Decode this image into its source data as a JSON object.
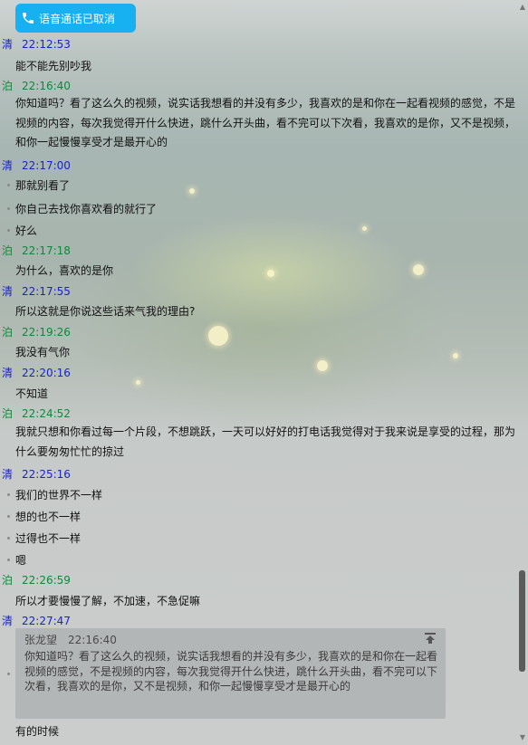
{
  "call_banner": {
    "text": "语音通话已取消",
    "icon": "phone-icon",
    "color": "#17b0f0"
  },
  "colors": {
    "qing": "#1a23c8",
    "bo": "#0a8a3a"
  },
  "messages": [
    {
      "sender": "清",
      "time": "22:12:53",
      "lines": [
        "能不能先别吵我"
      ]
    },
    {
      "sender": "泊",
      "time": "22:16:40",
      "paragraph": "你知道吗？看了这么久的视频，说实话我想看的并没有多少，我喜欢的是和你在一起看视频的感觉，不是视频的内容，每次我觉得开什么快进，跳什么开头曲，看不完可以下次看，我喜欢的是你，又不是视频，和你一起慢慢享受才是最开心的"
    },
    {
      "sender": "清",
      "time": "22:17:00",
      "lines": [
        "那就别看了",
        "你自己去找你喜欢看的就行了",
        "好么"
      ]
    },
    {
      "sender": "泊",
      "time": "22:17:18",
      "lines": [
        "为什么，喜欢的是你"
      ]
    },
    {
      "sender": "清",
      "time": "22:17:55",
      "lines": [
        "所以这就是你说这些话来气我的理由?"
      ]
    },
    {
      "sender": "泊",
      "time": "22:19:26",
      "lines": [
        "我没有气你"
      ]
    },
    {
      "sender": "清",
      "time": "22:20:16",
      "lines": [
        "不知道"
      ]
    },
    {
      "sender": "泊",
      "time": "22:24:52",
      "paragraph": "我就只想和你看过每一个片段，不想跳跃，一天可以好好的打电话我觉得对于我来说是享受的过程，那为什么要匆匆忙忙的掠过"
    },
    {
      "sender": "清",
      "time": "22:25:16",
      "lines": [
        "我们的世界不一样",
        "想的也不一样",
        "过得也不一样",
        "嗯"
      ]
    },
    {
      "sender": "泊",
      "time": "22:26:59",
      "lines": [
        "所以才要慢慢了解，不加速，不急促嘛"
      ]
    },
    {
      "sender": "清",
      "time": "22:27:47",
      "lines": [
        "有的时候"
      ]
    }
  ],
  "quote": {
    "name": "张龙望",
    "time": "22:16:40",
    "text": "你知道吗？看了这么久的视频，说实话我想看的并没有多少，我喜欢的是和你在一起看视频的感觉，不是视频的内容，每次我觉得开什么快进，跳什么开头曲，看不完可以下次看，我喜欢的是你，又不是视频，和你一起慢慢享受才是最开心的",
    "icon": "scroll-to-top-icon"
  },
  "scrollbar": {
    "up_icon": "arrow-up-icon",
    "down_icon": "arrow-down-icon"
  }
}
